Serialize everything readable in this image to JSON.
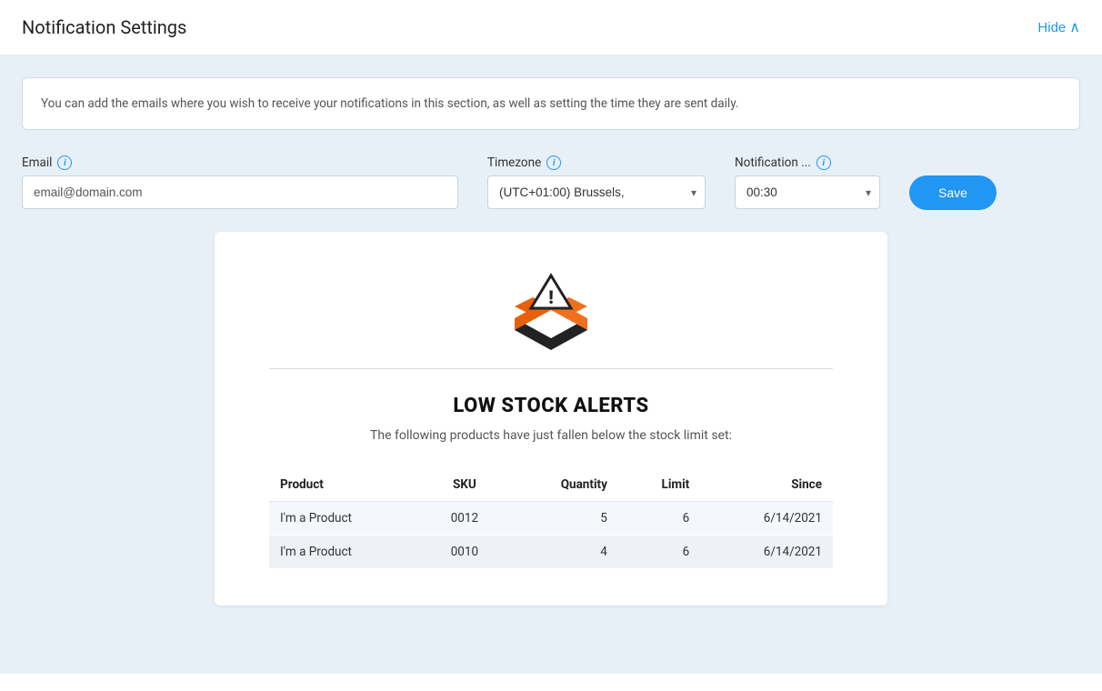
{
  "header": {
    "title": "Notification Settings",
    "hide_label": "Hide",
    "chevron": "∧"
  },
  "info_box": {
    "text": "You can add the emails where you wish to receive your notifications in this section, as well as setting the time they are sent daily."
  },
  "form": {
    "email_label": "Email",
    "email_placeholder": "email@domain.com",
    "email_value": "email@domain.com",
    "timezone_label": "Timezone",
    "timezone_value": "(UTC+01:00) Brussels,",
    "notification_label": "Notification ...",
    "notification_value": "00:30",
    "save_label": "Save"
  },
  "email_preview": {
    "alert_title": "LOW STOCK ALERTS",
    "alert_subtitle": "The following products have just fallen below the stock limit set:",
    "table": {
      "columns": [
        "Product",
        "SKU",
        "Quantity",
        "Limit",
        "Since"
      ],
      "rows": [
        {
          "product": "I'm a Product",
          "sku": "0012",
          "quantity": "5",
          "limit": "6",
          "since": "6/14/2021"
        },
        {
          "product": "I'm a Product",
          "sku": "0010",
          "quantity": "4",
          "limit": "6",
          "since": "6/14/2021"
        }
      ]
    }
  }
}
